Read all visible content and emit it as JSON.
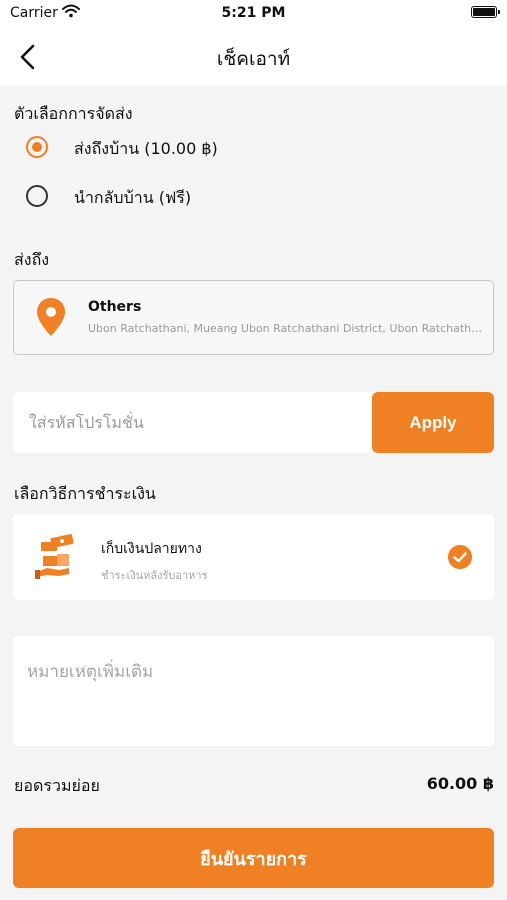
{
  "status_bar": {
    "carrier": "Carrier",
    "time": "5:21 PM"
  },
  "header": {
    "title": "เช็คเอาท์"
  },
  "delivery": {
    "label": "ตัวเลือกการจัดส่ง",
    "options": [
      {
        "label": "ส่งถึงบ้าน (10.00 ฿)",
        "selected": true
      },
      {
        "label": "นำกลับบ้าน (ฟรี)",
        "selected": false
      }
    ]
  },
  "ship_to": {
    "label": "ส่งถึง",
    "address_title": "Others",
    "address_detail": "Ubon Ratchathani, Mueang Ubon Ratchathani District, Ubon Ratchathani"
  },
  "promo": {
    "placeholder": "ใส่รหัสโปรโมชั่น",
    "value": "",
    "apply_label": "Apply"
  },
  "payment": {
    "label": "เลือกวิธีการชำระเงิน",
    "method_title": "เก็บเงินปลายทาง",
    "method_subtitle": "ชำระเงินหลังรับอาหาร"
  },
  "note": {
    "placeholder": "หมายเหตุเพิ่มเติม",
    "value": ""
  },
  "summary": {
    "subtotal_label": "ยอดรวมย่อย",
    "subtotal_value": "60.00 ฿"
  },
  "confirm": {
    "label": "ยืนยันรายการ"
  },
  "colors": {
    "accent": "#f08024",
    "background": "#f4f4f4",
    "card": "#ffffff"
  }
}
